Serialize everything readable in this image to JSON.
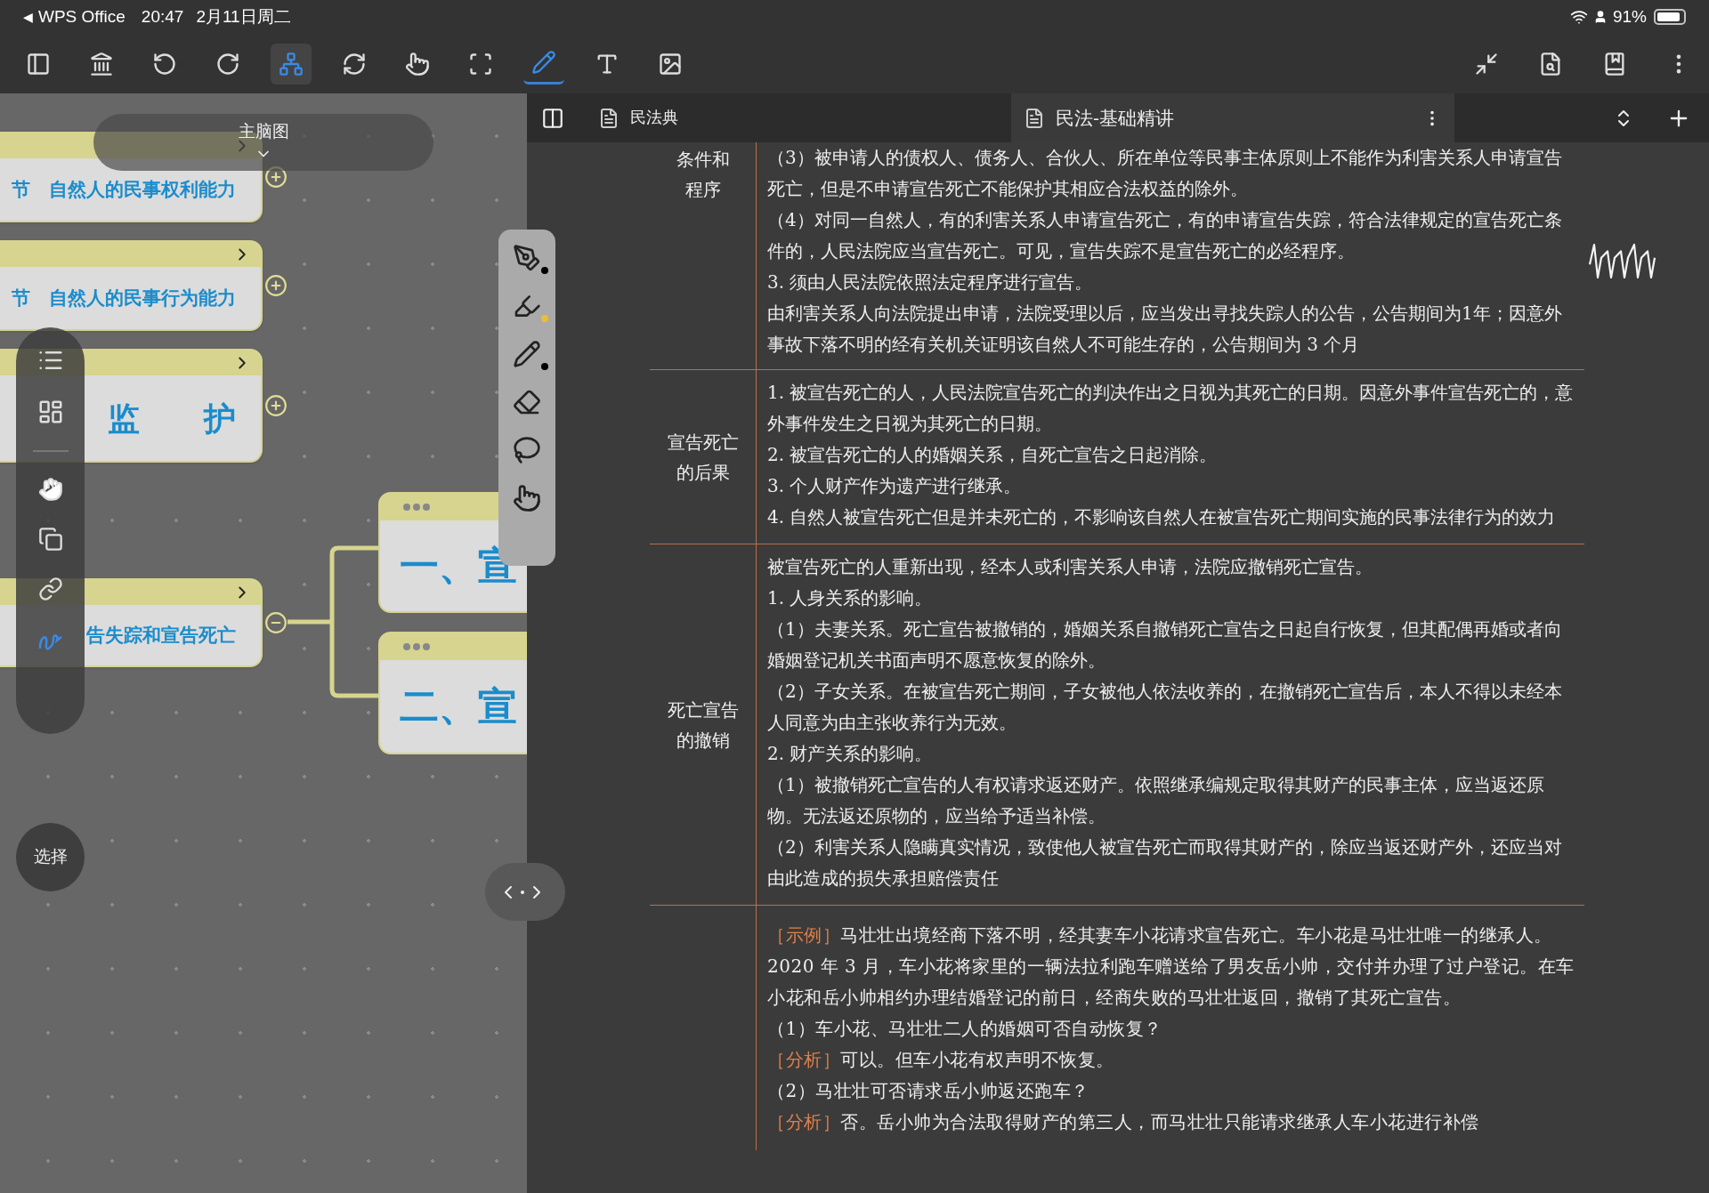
{
  "status_bar": {
    "back_arrow": "◀",
    "back_label": "WPS Office",
    "time": "20:47",
    "date": "2月11日周二",
    "battery": "91%"
  },
  "toolbar": {
    "tools": [
      {
        "selected": false
      },
      {
        "selected": false
      },
      {
        "selected": false
      },
      {
        "selected": false
      },
      {
        "selected": true
      },
      {
        "selected": false
      },
      {
        "selected": false
      },
      {
        "selected": false
      },
      {
        "selected": true
      },
      {
        "selected": false
      },
      {
        "selected": false
      }
    ]
  },
  "mind_map": {
    "title": "主脑图",
    "cards": [
      {
        "text": "节　自然人的民事权利能力",
        "expanded": false
      },
      {
        "text": "节　自然人的民事行为能力",
        "expanded": false
      },
      {
        "text": "监　　护",
        "expanded": false
      },
      {
        "text": "告失踪和宣告死亡",
        "expanded": true
      }
    ],
    "children": [
      {
        "text": "一、宣"
      },
      {
        "text": "二、宣"
      }
    ],
    "select_button": "选择"
  },
  "pen_palette": {
    "pens": [
      {
        "color": "#000000"
      },
      {
        "color": "#e8c030"
      },
      {
        "color": "#000000"
      }
    ]
  },
  "doc_tabs": [
    {
      "label": "民法典",
      "selected": false
    },
    {
      "label": "民法-基础精讲",
      "selected": true
    }
  ],
  "document": {
    "rows": [
      {
        "label": "条件和程序",
        "paragraphs": [
          {
            "text": "（3）被申请人的债权人、债务人、合伙人、所在单位等民事主体原则上不能作为利害关系人申请宣告死亡，但是不申请宣告死亡不能保护其相应合法权益的除外。"
          },
          {
            "text": "（4）对同一自然人，有的利害关系人申请宣告死亡，有的申请宣告失踪，符合法律规定的宣告死亡条件的，人民法院应当宣告死亡。可见，宣告失踪不是宣告死亡的必经程序。"
          },
          {
            "text": "3. 须由人民法院依照法定程序进行宣告。"
          },
          {
            "text": "由利害关系人向法院提出申请，法院受理以后，应当发出寻找失踪人的公告，公告期间为1年；因意外事故下落不明的经有关机关证明该自然人不可能生存的，公告期间为 3 个月"
          }
        ]
      },
      {
        "label": "宣告死亡的后果",
        "paragraphs": [
          {
            "text": "1. 被宣告死亡的人，人民法院宣告死亡的判决作出之日视为其死亡的日期。因意外事件宣告死亡的，意外事件发生之日视为其死亡的日期。"
          },
          {
            "text": "2. 被宣告死亡的人的婚姻关系，自死亡宣告之日起消除。"
          },
          {
            "text": "3. 个人财产作为遗产进行继承。"
          },
          {
            "text": "4. 自然人被宣告死亡但是并未死亡的，不影响该自然人在被宣告死亡期间实施的民事法律行为的效力"
          }
        ]
      },
      {
        "label": "死亡宣告的撤销",
        "paragraphs": [
          {
            "text": "被宣告死亡的人重新出现，经本人或利害关系人申请，法院应撤销死亡宣告。"
          },
          {
            "text": "1. 人身关系的影响。"
          },
          {
            "text": "（1）夫妻关系。死亡宣告被撤销的，婚姻关系自撤销死亡宣告之日起自行恢复，但其配偶再婚或者向婚姻登记机关书面声明不愿意恢复的除外。"
          },
          {
            "text": "（2）子女关系。在被宣告死亡期间，子女被他人依法收养的，在撤销死亡宣告后，本人不得以未经本人同意为由主张收养行为无效。"
          },
          {
            "text": "2. 财产关系的影响。"
          },
          {
            "text": "（1）被撤销死亡宣告的人有权请求返还财产。依照继承编规定取得其财产的民事主体，应当返还原物。无法返还原物的，应当给予适当补偿。"
          },
          {
            "text": "（2）利害关系人隐瞒真实情况，致使他人被宣告死亡而取得其财产的，除应当返还财产外，还应当对由此造成的损失承担赔偿责任"
          }
        ]
      },
      {
        "paragraphs": [
          {
            "tag": "［示例］",
            "text": "马壮壮出境经商下落不明，经其妻车小花请求宣告死亡。车小花是马壮壮唯一的继承人。2020 年 3 月，车小花将家里的一辆法拉利跑车赠送给了男友岳小帅，交付并办理了过户登记。在车小花和岳小帅相约办理结婚登记的前日，经商失败的马壮壮返回，撤销了其死亡宣告。"
          },
          {
            "text": "（1）车小花、马壮壮二人的婚姻可否自动恢复？"
          },
          {
            "tag": "［分析］",
            "text": "可以。但车小花有权声明不恢复。"
          },
          {
            "text": "（2）马壮壮可否请求岳小帅返还跑车？"
          },
          {
            "tag": "［分析］",
            "text": "否。岳小帅为合法取得财产的第三人，而马壮壮只能请求继承人车小花进行补偿"
          }
        ]
      }
    ]
  }
}
